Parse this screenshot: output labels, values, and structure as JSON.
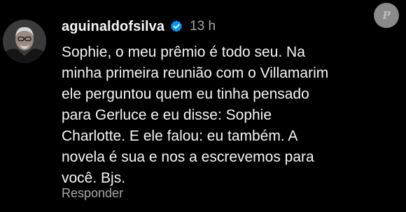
{
  "comment": {
    "username": "aguinaldofsilva",
    "verified_icon": "verified-badge-icon",
    "timestamp": "13 h",
    "text_lines": [
      "Sophie, o meu prêmio é todo seu. Na",
      "minha primeira reunião com o Villamarim",
      "ele perguntou quem eu tinha pensado",
      "para Gerluce e eu disse:  Sophie",
      "Charlotte. E ele falou: eu também. A",
      "novela é sua e nos a escrevemos para",
      "você. Bjs."
    ],
    "reply_label": "Responder"
  },
  "watermark": {
    "letter": "P"
  },
  "colors": {
    "background": "#000000",
    "text": "#f5f5f5",
    "secondary": "#a8a8a8",
    "verified": "#0095f6"
  }
}
